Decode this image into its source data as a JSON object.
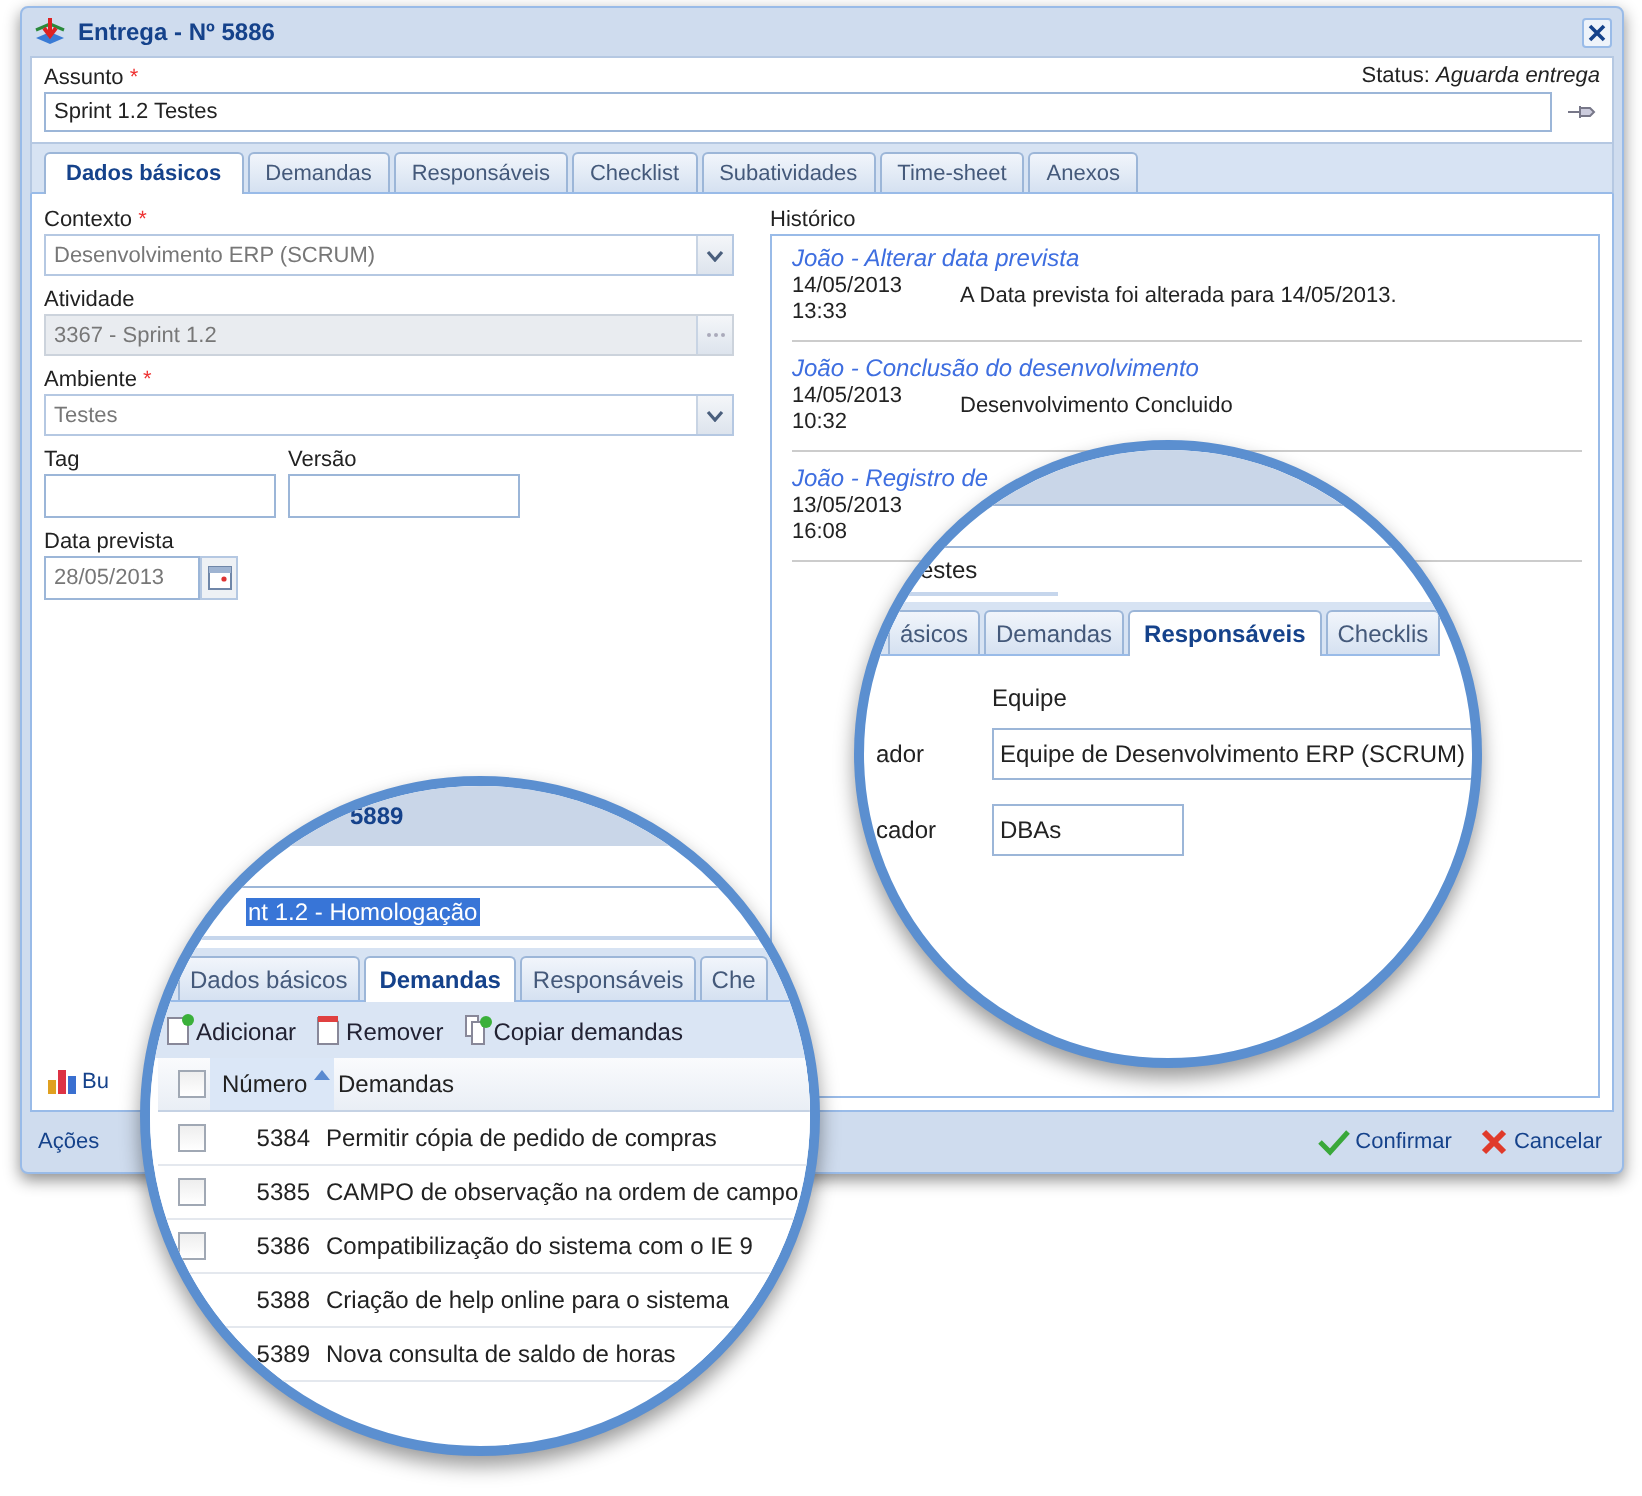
{
  "window": {
    "title": "Entrega - Nº 5886"
  },
  "subject": {
    "label": "Assunto",
    "mark": "*",
    "status": "Status: *Aguarda entrega*",
    "value": "Sprint 1.2 Testes"
  },
  "tabs": [
    {
      "label": "Dados básicos",
      "selected": true
    },
    {
      "label": "Demandas",
      "selected": false
    },
    {
      "label": "Responsáveis",
      "selected": false
    },
    {
      "label": "Checklist",
      "selected": false
    },
    {
      "label": "Subatividades",
      "selected": false
    },
    {
      "label": "Time-sheet",
      "selected": false
    },
    {
      "label": "Anexos",
      "selected": false
    }
  ],
  "basic": {
    "fields": [
      {
        "kind": "combo",
        "label": "Contexto",
        "mark": "*",
        "value": "Desenvolvimento ERP (SCRUM)",
        "disabled": false
      },
      {
        "kind": "lookup",
        "label": "Atividade",
        "value": "3367 - Sprint 1.2",
        "disabled": true
      },
      {
        "kind": "combo",
        "label": "Ambiente",
        "mark": "*",
        "value": "Testes",
        "disabled": false
      }
    ],
    "small_fields": [
      {
        "label": "Tag"
      },
      {
        "label": "Versão"
      }
    ],
    "due": {
      "label": "Data prevista",
      "value": "28/05/2013"
    },
    "chart_button": "Bu"
  },
  "history": {
    "label": "Histórico",
    "entries": [
      {
        "title": "João - Alterar data prevista",
        "date": "14/05/2013",
        "time": "13:33",
        "message": "A Data prevista foi alterada para 14/05/2013."
      },
      {
        "title": "João - Conclusão do desenvolvimento",
        "date": "14/05/2013",
        "time": "10:32",
        "message": "Desenvolvimento Concluido"
      },
      {
        "title": "João - Registro de",
        "date": "13/05/2013",
        "time": "16:08"
      }
    ]
  },
  "footer": {
    "actions": "Ações",
    "buttons": [
      {
        "kind": "confirm",
        "label": "Confirmar"
      },
      {
        "kind": "cancel",
        "label": "Cancelar"
      }
    ]
  },
  "zoom_responsaveis": {
    "subject": "estes",
    "tabs": [
      {
        "label": "ásicos",
        "selected": false
      },
      {
        "label": "Demandas",
        "selected": false
      },
      {
        "label": "Responsáveis",
        "selected": true
      },
      {
        "label": "Checklis",
        "selected": false
      }
    ],
    "column_label": "Equipe",
    "rows": [
      {
        "label": "ador",
        "value": "Equipe de Desenvolvimento ERP (SCRUM)"
      },
      {
        "label": "cador",
        "value": "DBAs"
      }
    ]
  },
  "zoom_demandas": {
    "title": "5889",
    "subject": "nt 1.2 - Homologação",
    "tabs": [
      {
        "label": "Dados básicos",
        "selected": false
      },
      {
        "label": "Demandas",
        "selected": true
      },
      {
        "label": "Responsáveis",
        "selected": false
      },
      {
        "label": "Che",
        "selected": false
      }
    ],
    "toolbar": [
      {
        "kind": "add",
        "label": "Adicionar"
      },
      {
        "kind": "remove",
        "label": "Remover"
      },
      {
        "kind": "copy",
        "label": "Copiar demandas"
      }
    ],
    "columns": [
      {
        "label": "Número",
        "sorted": true
      },
      {
        "label": "Demandas",
        "sorted": false
      }
    ],
    "all_checked": false,
    "rows": [
      {
        "number": "5384",
        "title": "Permitir cópia de pedido de compras",
        "checked": false
      },
      {
        "number": "5385",
        "title": "CAMPO de observação na ordem de campo",
        "checked": false
      },
      {
        "number": "5386",
        "title": "Compatibilização do sistema com o IE 9",
        "checked": false
      },
      {
        "number": "5388",
        "title": "Criação de help online para o sistema"
      },
      {
        "number": "5389",
        "title": "Nova consulta de saldo de horas"
      }
    ]
  }
}
